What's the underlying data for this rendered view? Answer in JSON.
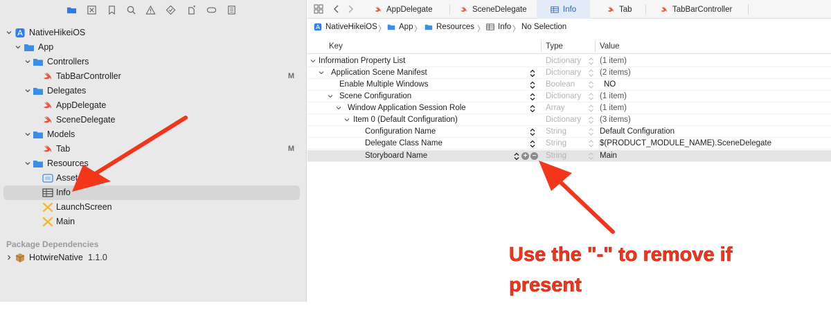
{
  "sidebar": {
    "toolbar_icons": [
      "folder-icon",
      "source-control-icon",
      "bookmark-icon",
      "search-icon",
      "warning-icon",
      "test-icon",
      "debug-icon",
      "breakpoint-icon",
      "report-icon"
    ],
    "tree": [
      {
        "label": "NativeHikeiOS",
        "icon": "app-project-icon",
        "badge": ""
      },
      {
        "label": "App",
        "icon": "folder-icon",
        "badge": ""
      },
      {
        "label": "Controllers",
        "icon": "folder-icon",
        "badge": ""
      },
      {
        "label": "TabBarController",
        "icon": "swift-icon",
        "badge": "M"
      },
      {
        "label": "Delegates",
        "icon": "folder-icon",
        "badge": ""
      },
      {
        "label": "AppDelegate",
        "icon": "swift-icon",
        "badge": ""
      },
      {
        "label": "SceneDelegate",
        "icon": "swift-icon",
        "badge": ""
      },
      {
        "label": "Models",
        "icon": "folder-icon",
        "badge": ""
      },
      {
        "label": "Tab",
        "icon": "swift-icon",
        "badge": "M"
      },
      {
        "label": "Resources",
        "icon": "folder-icon",
        "badge": ""
      },
      {
        "label": "Assets",
        "icon": "asset-catalog-icon",
        "badge": ""
      },
      {
        "label": "Info",
        "icon": "plist-icon",
        "badge": ""
      },
      {
        "label": "LaunchScreen",
        "icon": "storyboard-icon",
        "badge": ""
      },
      {
        "label": "Main",
        "icon": "storyboard-icon",
        "badge": ""
      }
    ],
    "package_header": "Package Dependencies",
    "package": {
      "label": "HotwireNative",
      "version": "1.1.0"
    }
  },
  "tabs": [
    {
      "label": "AppDelegate",
      "icon": "swift-icon"
    },
    {
      "label": "SceneDelegate",
      "icon": "swift-icon"
    },
    {
      "label": "Info",
      "icon": "plist-icon",
      "active": true
    },
    {
      "label": "Tab",
      "icon": "swift-icon"
    },
    {
      "label": "TabBarController",
      "icon": "swift-icon"
    }
  ],
  "jumpbar": [
    "NativeHikeiOS",
    "App",
    "Resources",
    "Info",
    "No Selection"
  ],
  "plist": {
    "headers": {
      "key": "Key",
      "type": "Type",
      "value": "Value"
    },
    "rows": [
      {
        "key": "Information Property List",
        "type": "Dictionary",
        "value": "(1 item)"
      },
      {
        "key": "Application Scene Manifest",
        "type": "Dictionary",
        "value": "(2 items)"
      },
      {
        "key": "Enable Multiple Windows",
        "type": "Boolean",
        "value": "NO"
      },
      {
        "key": "Scene Configuration",
        "type": "Dictionary",
        "value": "(1 item)"
      },
      {
        "key": "Window Application Session Role",
        "type": "Array",
        "value": "(1 item)"
      },
      {
        "key": "Item 0 (Default Configuration)",
        "type": "Dictionary",
        "value": "(3 items)"
      },
      {
        "key": "Configuration Name",
        "type": "String",
        "value": "Default Configuration"
      },
      {
        "key": "Delegate Class Name",
        "type": "String",
        "value": "$(PRODUCT_MODULE_NAME).SceneDelegate"
      },
      {
        "key": "Storyboard Name",
        "type": "String",
        "value": "Main"
      }
    ]
  },
  "annotation": {
    "text": "Use the \"-\" to remove if present"
  },
  "colors": {
    "accent": "#2a62c9",
    "swift": "#f05138",
    "folder": "#3b8ee6",
    "annotation": "#f2361c",
    "selected_row": "#d6d6d6"
  }
}
